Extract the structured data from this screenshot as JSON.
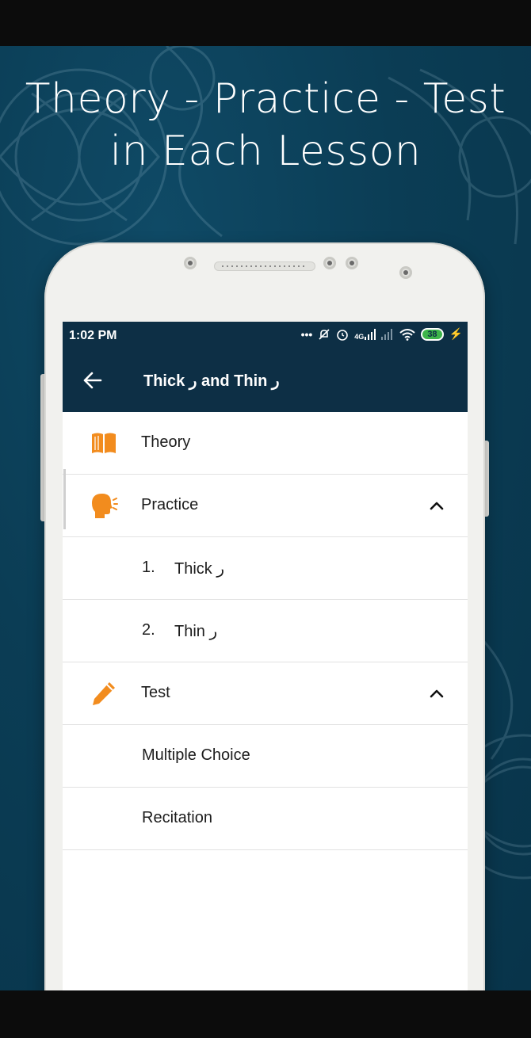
{
  "promo": {
    "headline_line1": "Theory - Practice - Test",
    "headline_line2": "in Each Lesson",
    "background_color": "#0b3d55"
  },
  "status_bar": {
    "time": "1:02 PM",
    "icons": [
      "more-dots-icon",
      "mute-icon",
      "alarm-icon",
      "signal-4g-icon",
      "signal-icon",
      "wifi-icon",
      "battery-icon",
      "charging-icon"
    ],
    "network_label": "4G",
    "battery_level": "38",
    "background_color": "#0d2f45"
  },
  "app_bar": {
    "title": "Thick ر and Thin ر",
    "back_icon": "arrow-left-icon",
    "background_color": "#0d2f45"
  },
  "menu": {
    "accent_color": "#f28c1e",
    "theory": {
      "label": "Theory",
      "icon": "open-book-icon"
    },
    "practice": {
      "label": "Practice",
      "icon": "speaking-head-icon",
      "expanded": true,
      "items": [
        {
          "num": "1.",
          "label": "Thick ر"
        },
        {
          "num": "2.",
          "label": "Thin ر"
        }
      ]
    },
    "test": {
      "label": "Test",
      "icon": "pencil-icon",
      "expanded": true,
      "items": [
        {
          "label": "Multiple Choice"
        },
        {
          "label": "Recitation"
        }
      ]
    }
  }
}
